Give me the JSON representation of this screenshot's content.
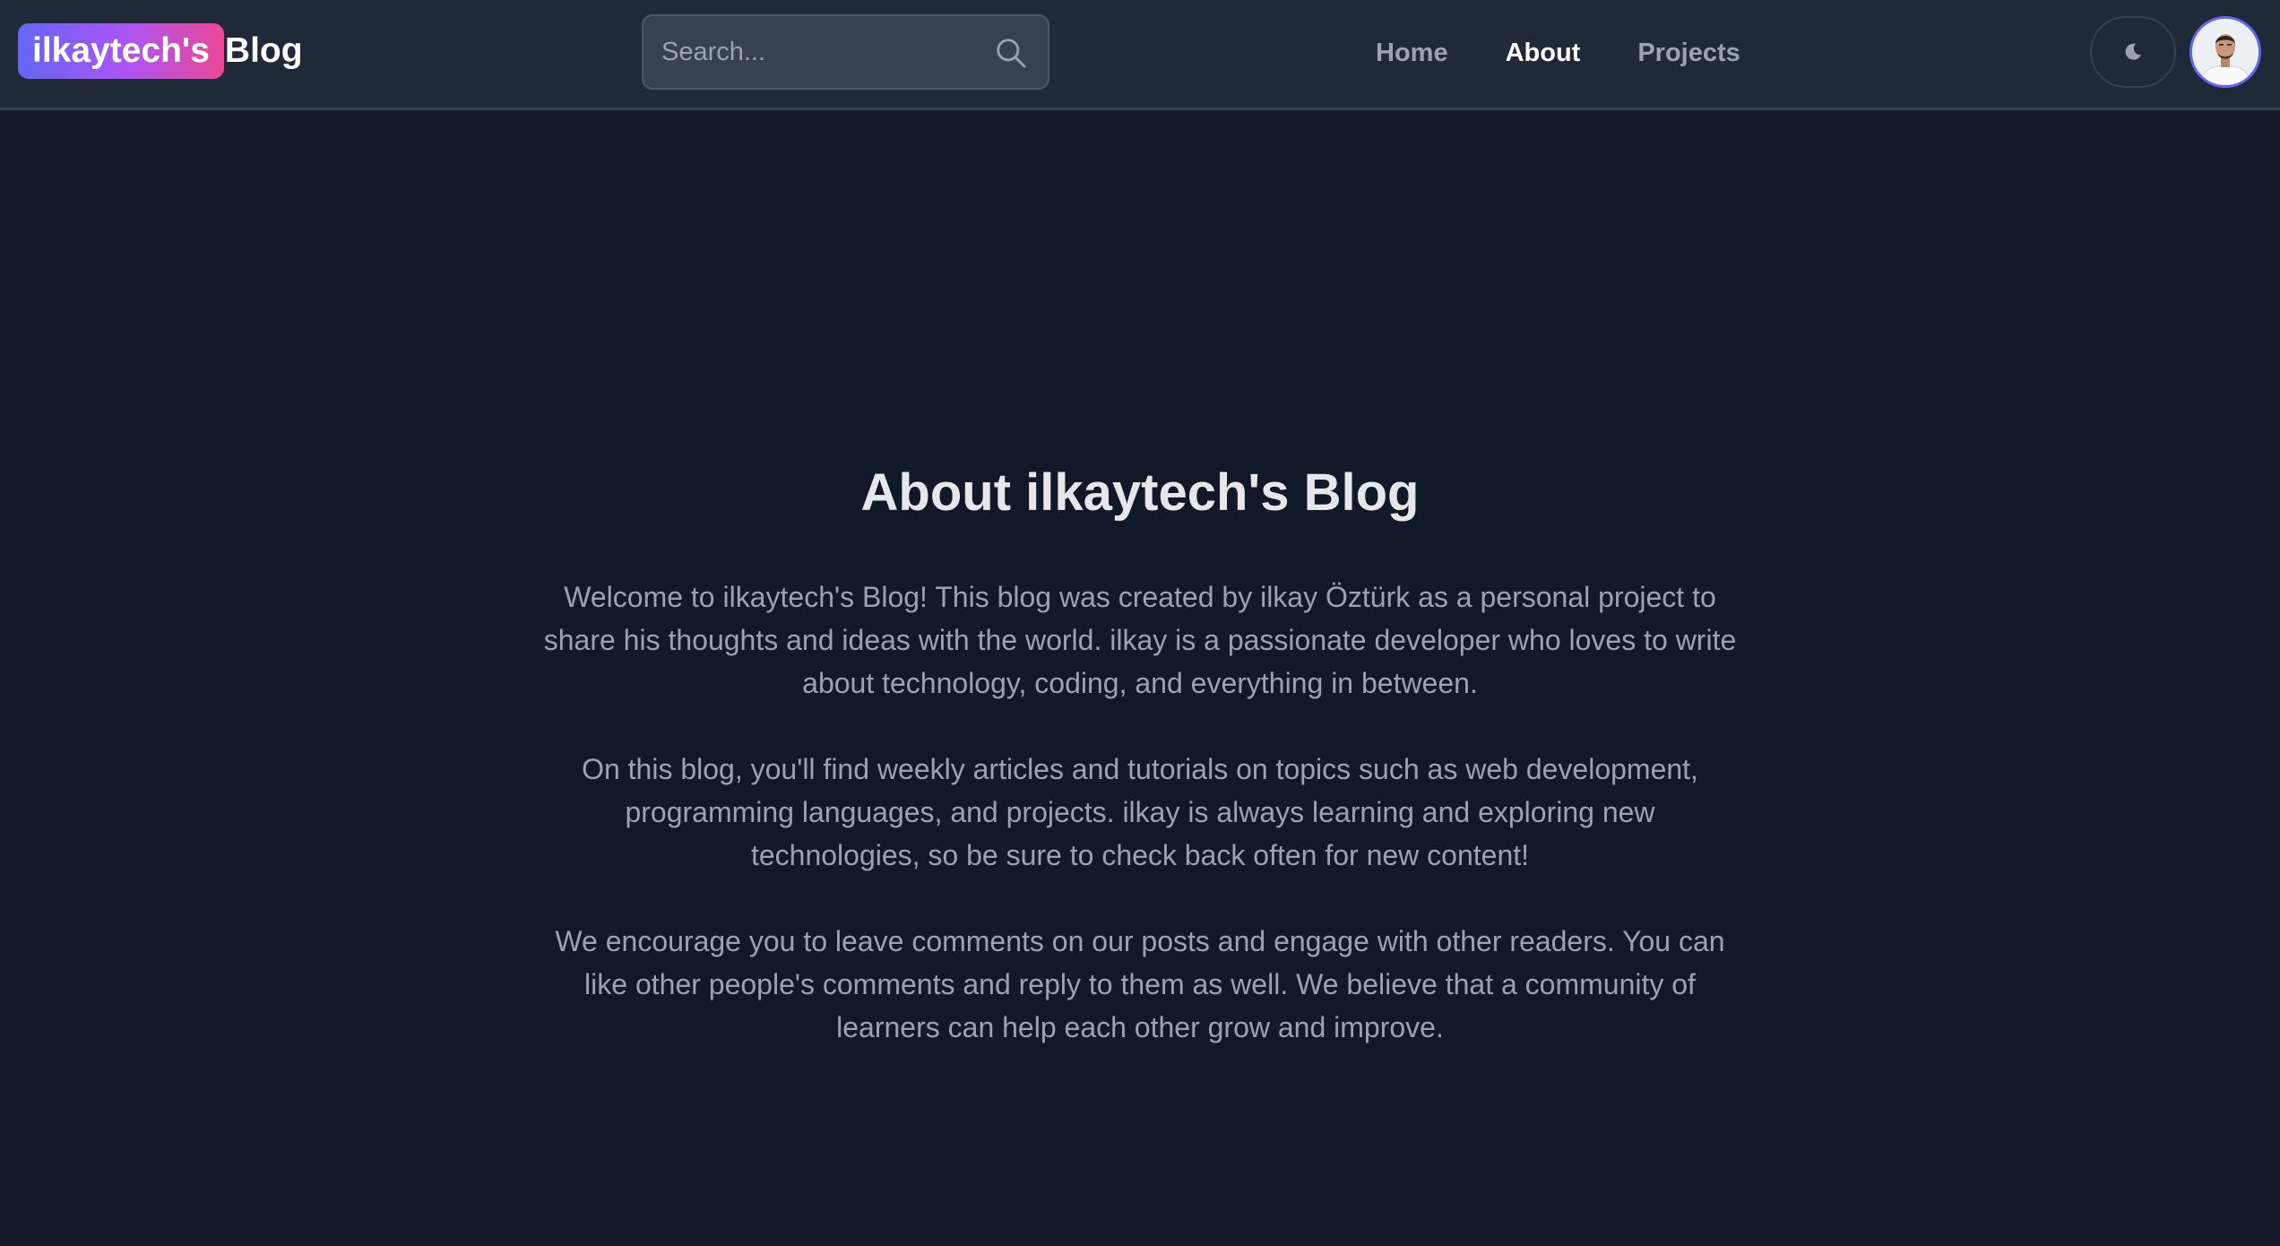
{
  "header": {
    "brand_highlight": "ilkaytech's",
    "brand_rest": "Blog",
    "search": {
      "placeholder": "Search...",
      "value": ""
    },
    "nav": [
      {
        "label": "Home",
        "active": false
      },
      {
        "label": "About",
        "active": true
      },
      {
        "label": "Projects",
        "active": false
      }
    ],
    "theme_toggle_icon": "moon-icon",
    "avatar_icon": "user-avatar"
  },
  "main": {
    "title": "About ilkaytech's Blog",
    "paragraphs": [
      "Welcome to ilkaytech's Blog! This blog was created by ilkay Öztürk as a personal project to share his thoughts and ideas with the world. ilkay is a passionate developer who loves to write about technology, coding, and everything in between.",
      "On this blog, you'll find weekly articles and tutorials on topics such as web development, programming languages, and projects. ilkay is always learning and exploring new technologies, so be sure to check back often for new content!",
      "We encourage you to leave comments on our posts and engage with other readers. You can like other people's comments and reply to them as well. We believe that a community of learners can help each other grow and improve."
    ]
  },
  "colors": {
    "background": "#111827",
    "header_background": "#1f2937",
    "brand_gradient_start": "#6366f1",
    "brand_gradient_mid": "#a855f7",
    "brand_gradient_end": "#ec4899",
    "text_primary": "#e5e7eb",
    "text_muted": "#9ca3af"
  }
}
